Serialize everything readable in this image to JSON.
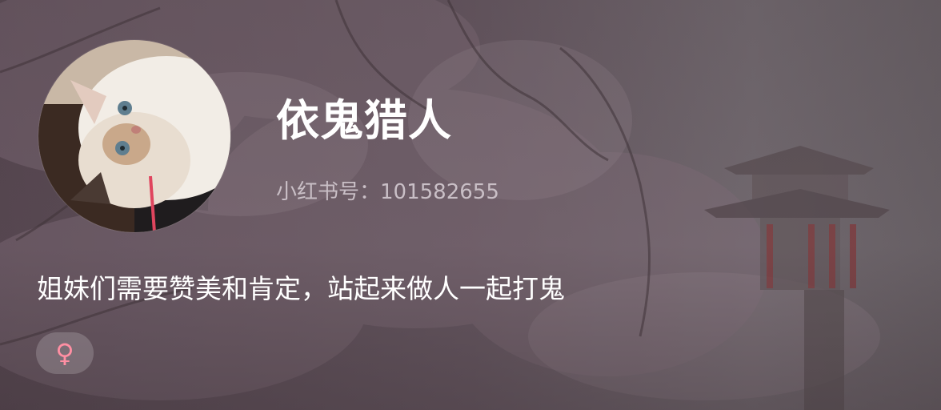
{
  "profile": {
    "nickname": "依鬼猎人",
    "id_text": "小红书号：101582655",
    "bio": "姐妹们需要赞美和肯定，站起来做人一起打鬼",
    "gender_icon": "female-icon",
    "gender_symbol": "♀",
    "gender_color": "#ff8fa3"
  },
  "colors": {
    "nickname": "#ffffff",
    "id_text": "#c9bfc6",
    "bio": "#ffffff",
    "background_overlay": "#4d4048"
  }
}
